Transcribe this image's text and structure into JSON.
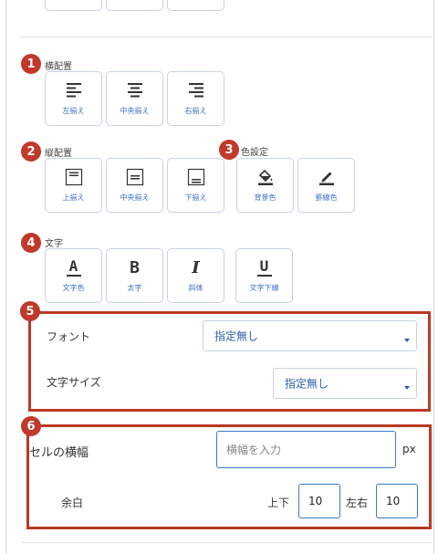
{
  "sections": {
    "horizontal_align": {
      "badge": "1",
      "title": "横配置",
      "buttons": [
        {
          "label": "左揃え",
          "icon": "align-left-icon"
        },
        {
          "label": "中央揃え",
          "icon": "align-center-icon"
        },
        {
          "label": "右揃え",
          "icon": "align-right-icon"
        }
      ]
    },
    "vertical_align": {
      "badge": "2",
      "title": "縦配置",
      "buttons": [
        {
          "label": "上揃え",
          "icon": "valign-top-icon"
        },
        {
          "label": "中央揃え",
          "icon": "valign-middle-icon"
        },
        {
          "label": "下揃え",
          "icon": "valign-bottom-icon"
        }
      ]
    },
    "color": {
      "badge": "3",
      "title": "色設定",
      "buttons": [
        {
          "label": "背景色",
          "icon": "paint-bucket-icon"
        },
        {
          "label": "罫線色",
          "icon": "pen-icon"
        }
      ]
    },
    "text": {
      "badge": "4",
      "title": "文字",
      "buttons": [
        {
          "label": "文字色",
          "glyph": "A",
          "icon": "text-color-icon"
        },
        {
          "label": "太字",
          "glyph": "B",
          "icon": "bold-icon"
        },
        {
          "label": "斜体",
          "glyph": "I",
          "icon": "italic-icon"
        },
        {
          "label": "文字下線",
          "glyph": "U",
          "icon": "underline-icon"
        }
      ]
    },
    "font": {
      "badge": "5",
      "font_label": "フォント",
      "font_value": "指定無し",
      "size_label": "文字サイズ",
      "size_value": "指定無し"
    },
    "cell": {
      "badge": "6",
      "width_label": "セルの横幅",
      "width_placeholder": "横幅を入力",
      "width_unit": "px",
      "padding_label": "余白",
      "vertical_label": "上下",
      "vertical_value": "10",
      "horizontal_label": "左右",
      "horizontal_value": "10"
    }
  },
  "colors": {
    "badge": "#c0392b",
    "highlight_border": "#b83a24",
    "link_blue": "#3a6fc4",
    "input_border": "#3b78c6"
  }
}
